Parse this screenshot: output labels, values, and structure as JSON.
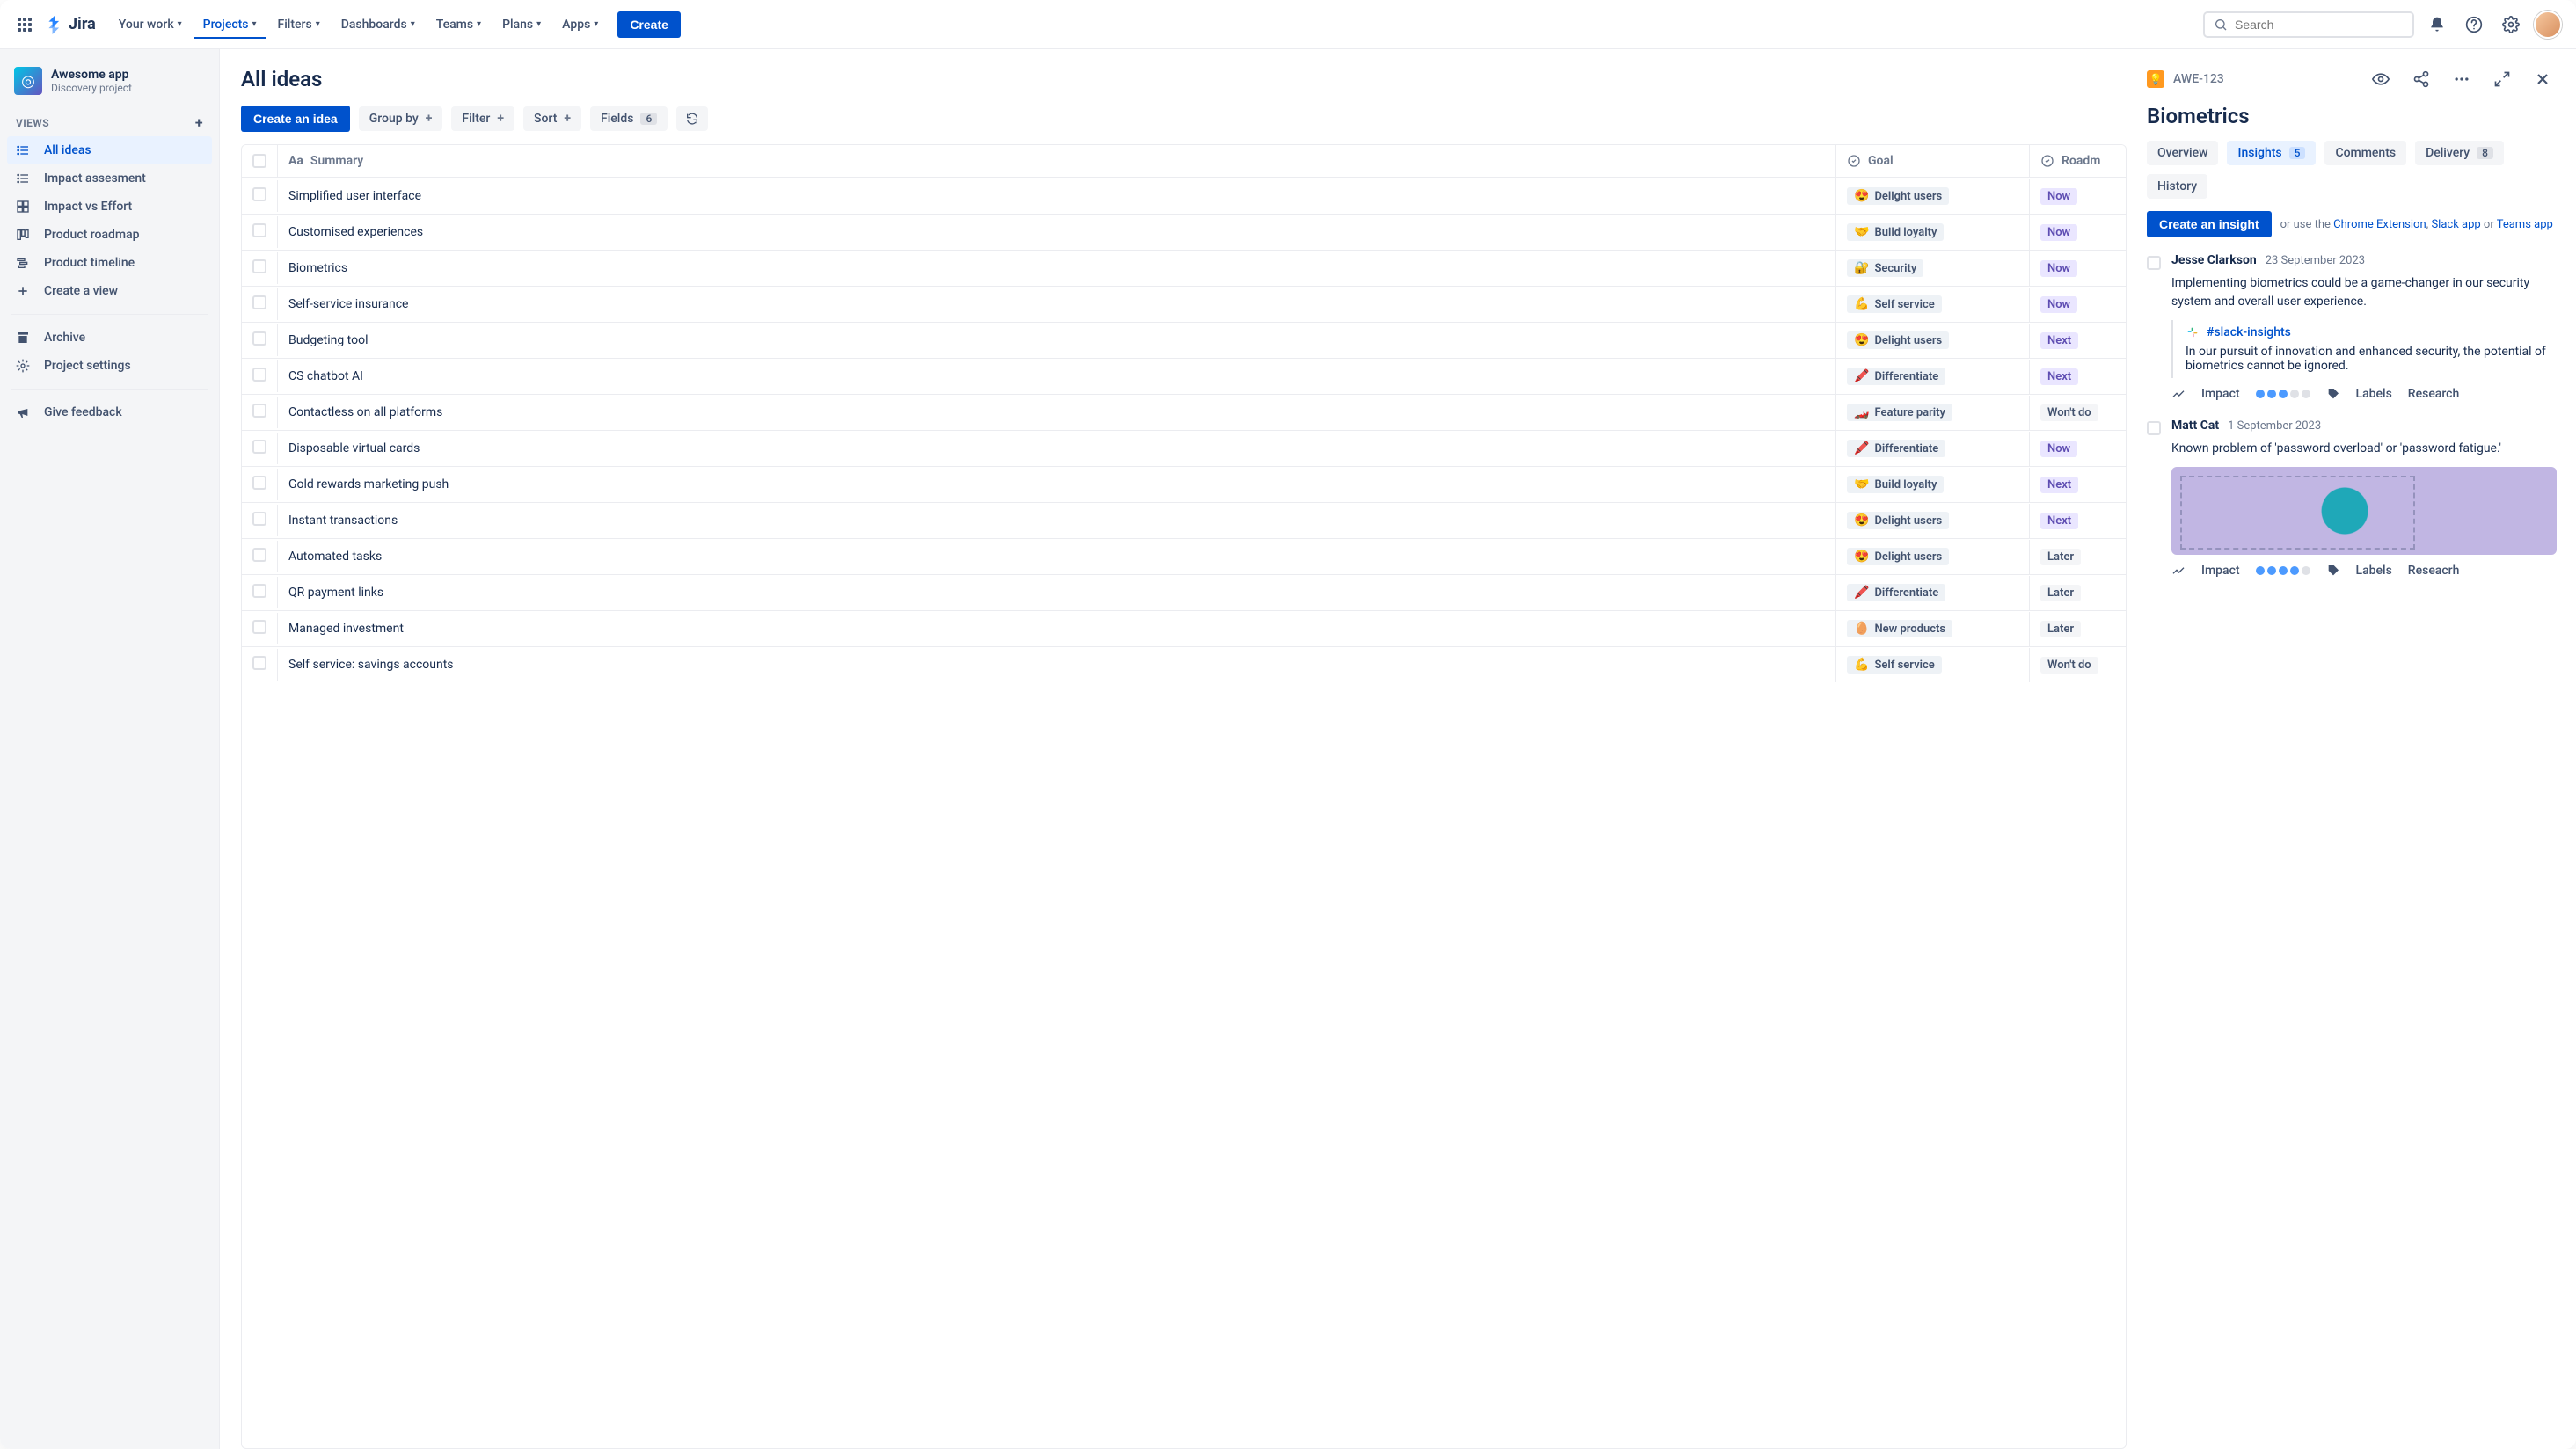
{
  "brand": "Jira",
  "nav": {
    "items": [
      "Your work",
      "Projects",
      "Filters",
      "Dashboards",
      "Teams",
      "Plans",
      "Apps"
    ],
    "activeIndex": 1,
    "createLabel": "Create"
  },
  "search": {
    "placeholder": "Search"
  },
  "project": {
    "name": "Awesome app",
    "subtitle": "Discovery project"
  },
  "sidebar": {
    "sectionLabel": "VIEWS",
    "views": [
      {
        "icon": "list",
        "label": "All ideas",
        "selected": true
      },
      {
        "icon": "list",
        "label": "Impact assesment"
      },
      {
        "icon": "matrix",
        "label": "Impact vs Effort"
      },
      {
        "icon": "board",
        "label": "Product roadmap"
      },
      {
        "icon": "timeline",
        "label": "Product timeline"
      },
      {
        "icon": "plus",
        "label": "Create a view"
      }
    ],
    "archiveLabel": "Archive",
    "settingsLabel": "Project settings",
    "feedbackLabel": "Give feedback"
  },
  "listView": {
    "title": "All ideas",
    "toolbar": {
      "createIdea": "Create an idea",
      "groupBy": "Group by",
      "filter": "Filter",
      "sort": "Sort",
      "fields": "Fields",
      "fieldsCount": "6"
    },
    "columns": {
      "summary": "Summary",
      "goal": "Goal",
      "roadmap": "Roadm"
    },
    "rows": [
      {
        "summary": "Simplified user interface",
        "goalEmoji": "😍",
        "goal": "Delight users",
        "roadmap": "Now"
      },
      {
        "summary": "Customised experiences",
        "goalEmoji": "🤝",
        "goal": "Build loyalty",
        "roadmap": "Now"
      },
      {
        "summary": "Biometrics",
        "goalEmoji": "🔐",
        "goal": "Security",
        "roadmap": "Now"
      },
      {
        "summary": "Self-service insurance",
        "goalEmoji": "💪",
        "goal": "Self service",
        "roadmap": "Now"
      },
      {
        "summary": "Budgeting tool",
        "goalEmoji": "😍",
        "goal": "Delight users",
        "roadmap": "Next"
      },
      {
        "summary": "CS chatbot AI",
        "goalEmoji": "🖍️",
        "goal": "Differentiate",
        "roadmap": "Next"
      },
      {
        "summary": "Contactless on all platforms",
        "goalEmoji": "🏎️",
        "goal": "Feature parity",
        "roadmap": "Won't do"
      },
      {
        "summary": "Disposable virtual cards",
        "goalEmoji": "🖍️",
        "goal": "Differentiate",
        "roadmap": "Now"
      },
      {
        "summary": "Gold rewards marketing push",
        "goalEmoji": "🤝",
        "goal": "Build loyalty",
        "roadmap": "Next"
      },
      {
        "summary": "Instant transactions",
        "goalEmoji": "😍",
        "goal": "Delight users",
        "roadmap": "Next"
      },
      {
        "summary": "Automated tasks",
        "goalEmoji": "😍",
        "goal": "Delight users",
        "roadmap": "Later"
      },
      {
        "summary": "QR payment links",
        "goalEmoji": "🖍️",
        "goal": "Differentiate",
        "roadmap": "Later"
      },
      {
        "summary": "Managed investment",
        "goalEmoji": "🥚",
        "goal": "New products",
        "roadmap": "Later"
      },
      {
        "summary": "Self service: savings accounts",
        "goalEmoji": "💪",
        "goal": "Self service",
        "roadmap": "Won't do"
      }
    ]
  },
  "detail": {
    "key": "AWE-123",
    "title": "Biometrics",
    "tabs": [
      {
        "label": "Overview"
      },
      {
        "label": "Insights",
        "count": "5",
        "active": true
      },
      {
        "label": "Comments"
      },
      {
        "label": "Delivery",
        "count": "8"
      },
      {
        "label": "History"
      }
    ],
    "createInsightLabel": "Create an insight",
    "helpPrefix": "or use the ",
    "helpLinks": [
      "Chrome Extension",
      "Slack app",
      "Teams app"
    ],
    "helpJoin1": ", ",
    "helpJoin2": " or ",
    "insights": [
      {
        "author": "Jesse Clarkson",
        "date": "23 September 2023",
        "text": "Implementing biometrics could be a game-changer in our security system and overall user experience.",
        "slackChannel": "#slack-insights",
        "quote": "In our pursuit of innovation and enhanced security, the potential of biometrics cannot be ignored.",
        "impactLabel": "Impact",
        "impactDots": 3,
        "impactMax": 5,
        "labelsLabel": "Labels",
        "researchLabel": "Research"
      },
      {
        "author": "Matt Cat",
        "date": "1 September 2023",
        "text": "Known problem of 'password overload' or 'password fatigue.'",
        "hasImage": true,
        "impactLabel": "Impact",
        "impactDots": 4,
        "impactMax": 5,
        "labelsLabel": "Labels",
        "researchLabel": "Reseacrh"
      }
    ]
  }
}
